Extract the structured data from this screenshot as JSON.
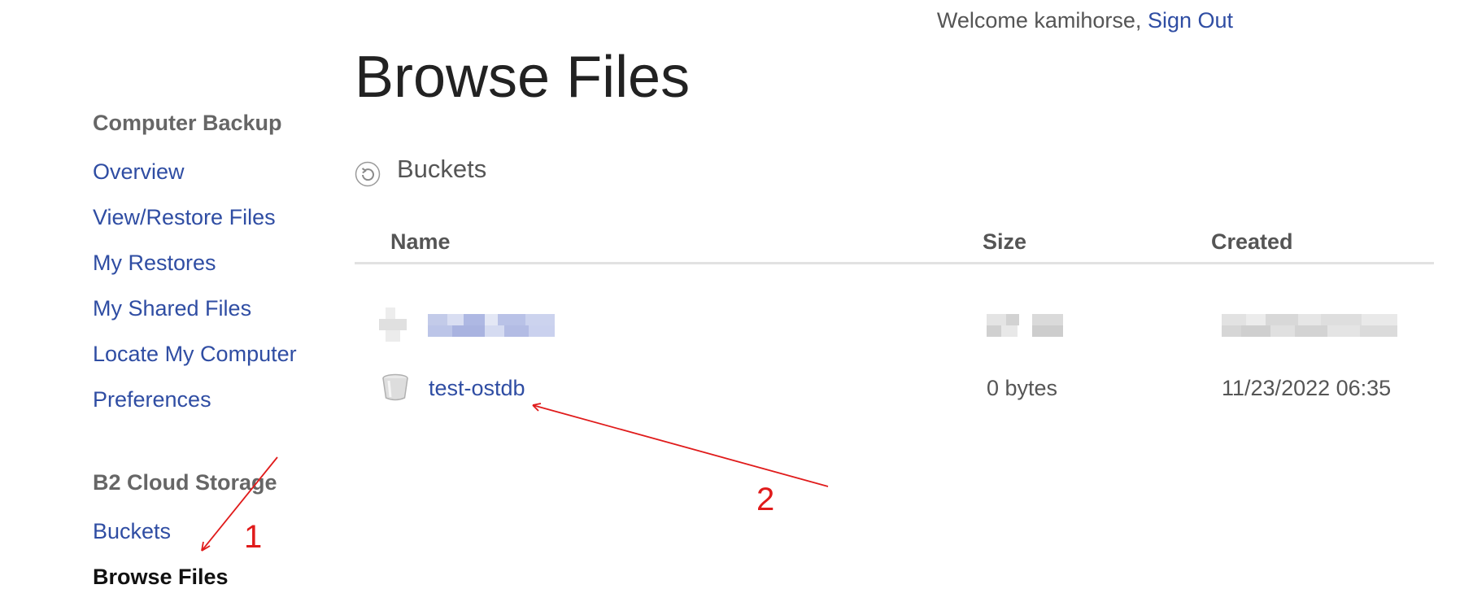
{
  "header": {
    "welcome_text": "Welcome kamihorse, ",
    "sign_out_label": "Sign Out"
  },
  "sidebar": {
    "section_backup": "Computer Backup",
    "backup_items": [
      "Overview",
      "View/Restore Files",
      "My Restores",
      "My Shared Files",
      "Locate My Computer",
      "Preferences"
    ],
    "section_b2": "B2 Cloud Storage",
    "b2_items": [
      "Buckets",
      "Browse Files"
    ],
    "active_item": "Browse Files"
  },
  "page_title": "Browse Files",
  "section": {
    "label": "Buckets",
    "icon": "refresh-icon"
  },
  "table": {
    "columns": [
      "Name",
      "Size",
      "Created"
    ],
    "rows": [
      {
        "name": "",
        "size": "",
        "created": "",
        "redacted": true,
        "icon": "bucket-icon"
      },
      {
        "name": "test-ostdb",
        "size": "0 bytes",
        "created": "11/23/2022 06:35",
        "redacted": false,
        "icon": "bucket-icon"
      }
    ]
  },
  "annotations": {
    "labels": [
      "1",
      "2"
    ],
    "color": "#e01b1b"
  },
  "colors": {
    "link": "#2f4da3",
    "heading": "#666666",
    "text": "#555555",
    "rule": "#e2e2e2"
  }
}
